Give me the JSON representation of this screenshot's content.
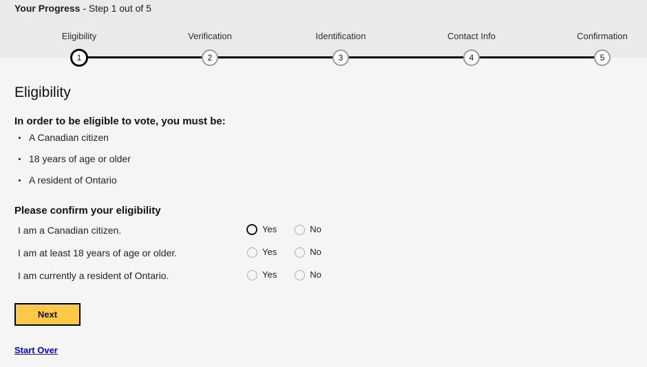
{
  "progress": {
    "title_bold": "Your Progress",
    "title_rest": " - Step 1 out of 5",
    "steps": [
      {
        "label": "Eligibility",
        "number": "1",
        "state": "active"
      },
      {
        "label": "Verification",
        "number": "2",
        "state": "upcoming"
      },
      {
        "label": "Identification",
        "number": "3",
        "state": "upcoming"
      },
      {
        "label": "Contact Info",
        "number": "4",
        "state": "upcoming"
      },
      {
        "label": "Confirmation",
        "number": "5",
        "state": "upcoming"
      }
    ]
  },
  "main": {
    "page_title": "Eligibility",
    "intro": "In order to be eligible to vote, you must be:",
    "requirements": [
      "A Canadian citizen",
      "18 years of age or older",
      "A resident of Ontario"
    ],
    "confirm_heading": "Please confirm your eligibility",
    "questions": [
      {
        "text": "I am a Canadian citizen.",
        "yes_label": "Yes",
        "no_label": "No",
        "yes_focused": true
      },
      {
        "text": "I am at least 18 years of age or older.",
        "yes_label": "Yes",
        "no_label": "No",
        "yes_focused": false
      },
      {
        "text": "I am currently a resident of Ontario.",
        "yes_label": "Yes",
        "no_label": "No",
        "yes_focused": false
      }
    ]
  },
  "footer": {
    "next_label": "Next",
    "start_over_label": "Start Over"
  },
  "colors": {
    "header_band": "#eaeaea",
    "page_background": "#f5f5f5",
    "button_yellow": "#fbc848",
    "link_blue": "#0000ee",
    "line_black": "#000000",
    "circle_grey": "#9a9a9a"
  }
}
